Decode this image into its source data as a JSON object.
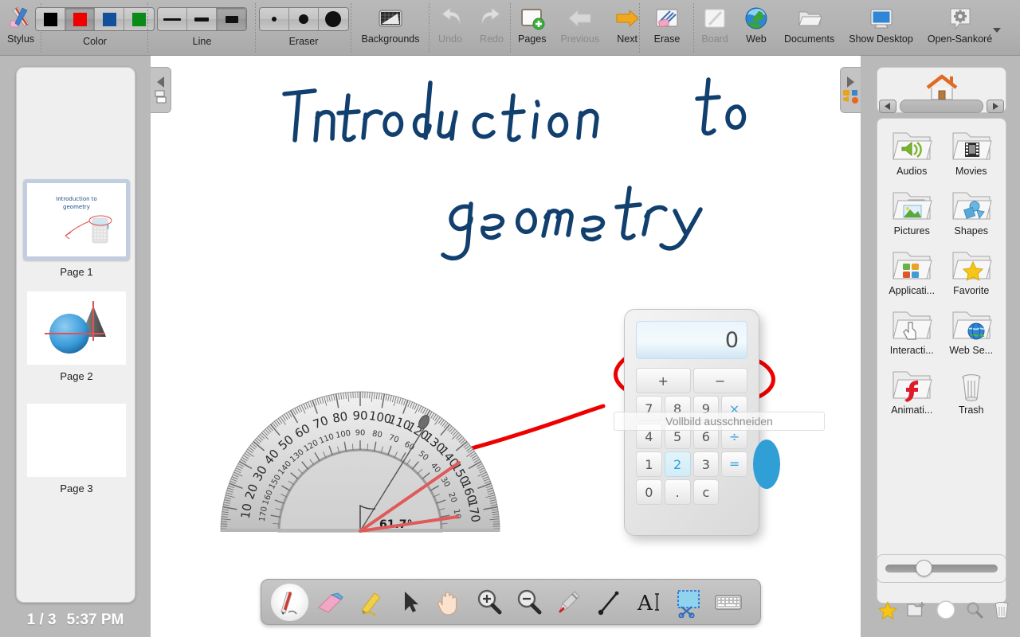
{
  "app": {
    "title": "Open-Sankoré"
  },
  "toolbar": {
    "groups": [
      {
        "name": "stylus",
        "label": "Stylus"
      },
      {
        "name": "color",
        "label": "Color"
      },
      {
        "name": "line",
        "label": "Line"
      },
      {
        "name": "eraser",
        "label": "Eraser"
      }
    ],
    "colors": [
      {
        "name": "black",
        "hex": "#000000",
        "selected": false
      },
      {
        "name": "red",
        "hex": "#ee0000",
        "selected": true
      },
      {
        "name": "blue",
        "hex": "#12509b",
        "selected": false
      },
      {
        "name": "green",
        "hex": "#0a8a16",
        "selected": false
      }
    ],
    "line_widths": [
      {
        "name": "thin",
        "selected": false
      },
      {
        "name": "medium",
        "selected": false
      },
      {
        "name": "thick",
        "selected": true
      }
    ],
    "eraser_sizes": [
      {
        "name": "small",
        "selected": false
      },
      {
        "name": "medium",
        "selected": false
      },
      {
        "name": "large",
        "selected": false
      }
    ],
    "actions": [
      {
        "name": "backgrounds",
        "label": "Backgrounds",
        "enabled": true
      },
      {
        "name": "undo",
        "label": "Undo",
        "enabled": false
      },
      {
        "name": "redo",
        "label": "Redo",
        "enabled": false
      },
      {
        "name": "pages",
        "label": "Pages",
        "enabled": true
      },
      {
        "name": "previous",
        "label": "Previous",
        "enabled": false
      },
      {
        "name": "next",
        "label": "Next",
        "enabled": true
      },
      {
        "name": "erase",
        "label": "Erase",
        "enabled": true
      },
      {
        "name": "board",
        "label": "Board",
        "enabled": false
      },
      {
        "name": "web",
        "label": "Web",
        "enabled": true
      },
      {
        "name": "documents",
        "label": "Documents",
        "enabled": true
      },
      {
        "name": "show-desktop",
        "label": "Show Desktop",
        "enabled": true
      },
      {
        "name": "open-sankore",
        "label": "Open-Sankoré",
        "enabled": true
      }
    ]
  },
  "pages_panel": {
    "pages": [
      {
        "label": "Page 1",
        "selected": true,
        "content": "title-calculator"
      },
      {
        "label": "Page 2",
        "selected": false,
        "content": "sphere-cone"
      },
      {
        "label": "Page 3",
        "selected": false,
        "content": "blank"
      }
    ],
    "status": {
      "page_counter": "1 / 3",
      "clock": "5:37 PM"
    }
  },
  "canvas": {
    "title_line1": "Introduction to",
    "title_line2": "geometry",
    "ink_color": "#12406e",
    "annotation_color": "#ee0000",
    "protractor": {
      "angle_label": "61.7°",
      "outer_ticks": [
        "10",
        "20",
        "30",
        "40",
        "50",
        "60",
        "70",
        "80",
        "90",
        "100",
        "110",
        "120",
        "130",
        "140",
        "150",
        "160",
        "170"
      ],
      "inner_ticks": [
        "10",
        "20",
        "30",
        "40",
        "50",
        "60",
        "70",
        "80",
        "90",
        "100",
        "110",
        "120",
        "130",
        "140",
        "150",
        "160",
        "170"
      ]
    },
    "calculator": {
      "display": "0",
      "keys": [
        "+",
        "−",
        "7",
        "8",
        "9",
        "×",
        "4",
        "5",
        "6",
        "÷",
        "1",
        "2",
        "3",
        "=",
        "0",
        ".",
        "c"
      ],
      "highlighted_key": "2"
    },
    "overlay_button": {
      "label": "Vollbild ausschneiden"
    }
  },
  "library": {
    "home_icon": "home-icon",
    "items": [
      {
        "name": "audios",
        "label": "Audios"
      },
      {
        "name": "movies",
        "label": "Movies"
      },
      {
        "name": "pictures",
        "label": "Pictures"
      },
      {
        "name": "shapes",
        "label": "Shapes"
      },
      {
        "name": "applications",
        "label": "Applicati..."
      },
      {
        "name": "favorite",
        "label": "Favorite"
      },
      {
        "name": "interactive",
        "label": "Interacti..."
      },
      {
        "name": "web-search",
        "label": "Web Se..."
      },
      {
        "name": "animations",
        "label": "Animati..."
      },
      {
        "name": "trash",
        "label": "Trash"
      }
    ],
    "footer_buttons": [
      "favorite-star-icon",
      "new-folder-icon",
      "circle-icon",
      "search-icon",
      "trash-icon"
    ]
  },
  "palette": {
    "tools": [
      {
        "name": "pen",
        "active": true
      },
      {
        "name": "eraser",
        "active": false
      },
      {
        "name": "marker",
        "active": false
      },
      {
        "name": "selector",
        "active": false
      },
      {
        "name": "hand",
        "active": false
      },
      {
        "name": "zoom-in",
        "active": false
      },
      {
        "name": "zoom-out",
        "active": false
      },
      {
        "name": "laser-pointer",
        "active": false
      },
      {
        "name": "line",
        "active": false
      },
      {
        "name": "text",
        "active": false
      },
      {
        "name": "capture",
        "active": false
      },
      {
        "name": "keyboard",
        "active": false
      }
    ]
  }
}
